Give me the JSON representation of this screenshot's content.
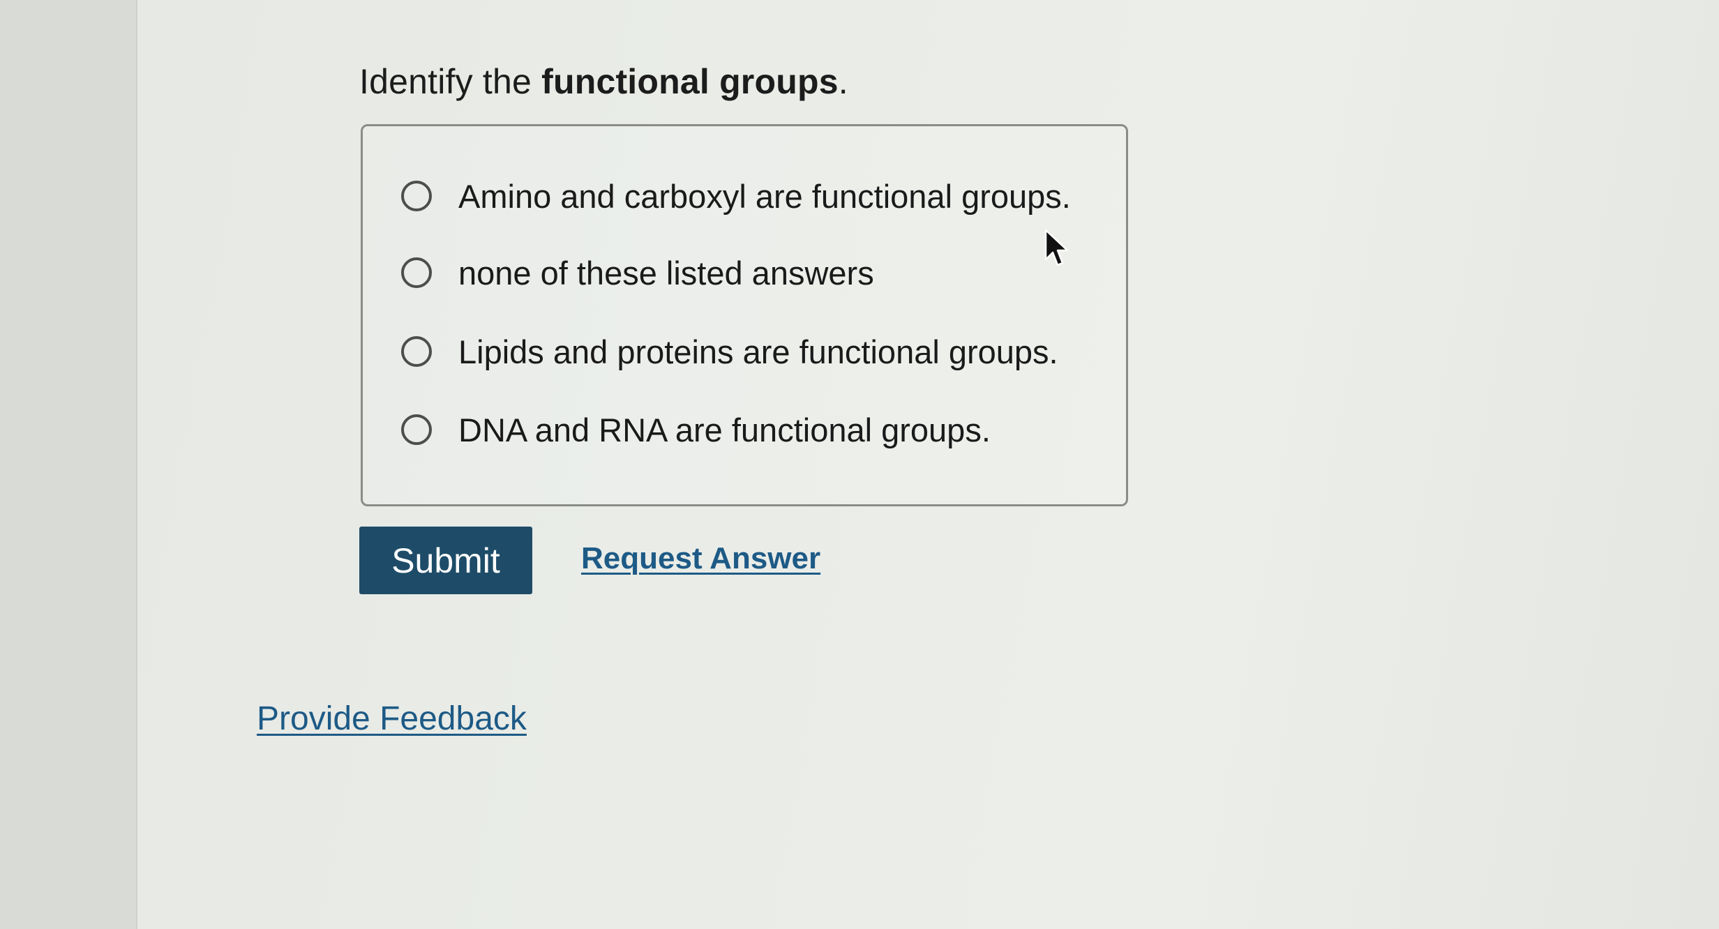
{
  "question": {
    "prefix": "Identify the ",
    "emphasis": "functional groups",
    "suffix": "."
  },
  "options": [
    {
      "label": "Amino and carboxyl are functional groups.",
      "selected": false
    },
    {
      "label": "none of these listed answers",
      "selected": false
    },
    {
      "label": "Lipids and proteins are functional groups.",
      "selected": false
    },
    {
      "label": "DNA and RNA are functional groups.",
      "selected": false
    }
  ],
  "actions": {
    "submit_label": "Submit",
    "request_answer_label": "Request Answer"
  },
  "footer": {
    "feedback_label": "Provide Feedback"
  },
  "colors": {
    "submit_bg": "#1e4c68",
    "link": "#1d5a86"
  },
  "icons": {
    "radio": "radio-unchecked-icon",
    "cursor": "mouse-pointer-icon"
  }
}
